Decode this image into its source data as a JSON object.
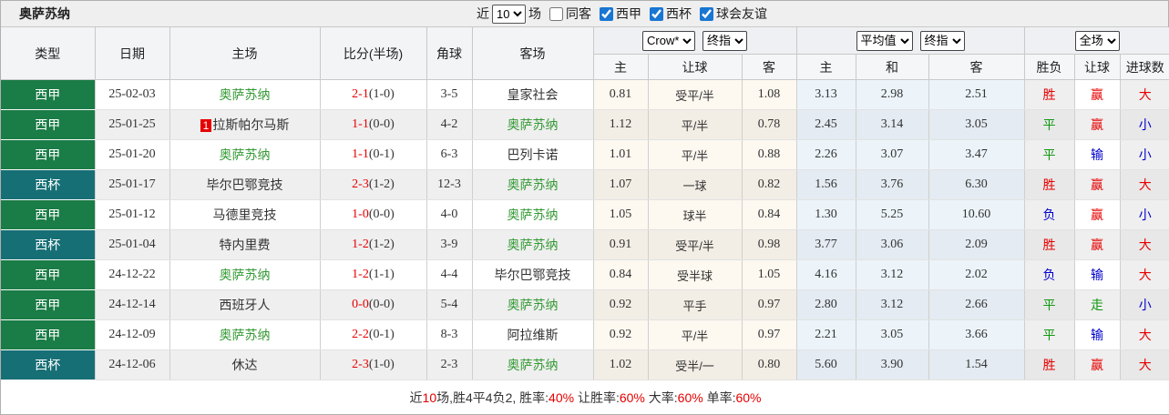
{
  "header": {
    "team": "奥萨苏纳",
    "recent_label": "近",
    "count": "10",
    "matches_label": "场",
    "filters": [
      {
        "label": "同客",
        "checked": false
      },
      {
        "label": "西甲",
        "checked": true
      },
      {
        "label": "西杯",
        "checked": true
      },
      {
        "label": "球会友谊",
        "checked": true
      }
    ]
  },
  "odds_selects": {
    "handicap_company": "Crow*",
    "handicap_stage": "终指",
    "euro_company": "平均值",
    "euro_stage": "终指",
    "scope": "全场"
  },
  "columns": {
    "type": "类型",
    "date": "日期",
    "home": "主场",
    "score": "比分(半场)",
    "corner": "角球",
    "away": "客场",
    "h_home": "主",
    "h_line": "让球",
    "h_away": "客",
    "e_home": "主",
    "e_draw": "和",
    "e_away": "客",
    "wdl": "胜负",
    "let": "让球",
    "goal": "进球数"
  },
  "colors": {
    "liga_green": "#1a7c46",
    "copa_teal": "#176f76",
    "self_team": "#339933",
    "win_red": "#e60000",
    "draw_green": "#119911",
    "lose_blue": "#0000cc"
  },
  "rows": [
    {
      "type": "西甲",
      "type_class": "liga",
      "date": "25-02-03",
      "home": "奥萨苏纳",
      "home_class": "self",
      "score": "2-1",
      "half": "(1-0)",
      "corners": "3-5",
      "away": "皇家社会",
      "h_home": "0.81",
      "h_line": "受平/半",
      "h_away": "1.08",
      "e_home": "3.13",
      "e_draw": "2.98",
      "e_away": "2.51",
      "res_wdl": "胜",
      "wdl_class": "c-red",
      "res_let": "赢",
      "let_class": "c-red",
      "res_goal": "大",
      "goal_class": "c-red"
    },
    {
      "type": "西甲",
      "type_class": "liga",
      "date": "25-01-25",
      "home_badge": "1",
      "home": "拉斯帕尔马斯",
      "score": "1-1",
      "half": "(0-0)",
      "corners": "4-2",
      "away": "奥萨苏纳",
      "away_class": "self",
      "h_home": "1.12",
      "h_line": "平/半",
      "h_away": "0.78",
      "e_home": "2.45",
      "e_draw": "3.14",
      "e_away": "3.05",
      "res_wdl": "平",
      "wdl_class": "c-green",
      "res_let": "赢",
      "let_class": "c-red",
      "res_goal": "小",
      "goal_class": "c-blue"
    },
    {
      "type": "西甲",
      "type_class": "liga",
      "date": "25-01-20",
      "home": "奥萨苏纳",
      "home_class": "self",
      "score": "1-1",
      "half": "(0-1)",
      "corners": "6-3",
      "away": "巴列卡诺",
      "h_home": "1.01",
      "h_line": "平/半",
      "h_away": "0.88",
      "e_home": "2.26",
      "e_draw": "3.07",
      "e_away": "3.47",
      "res_wdl": "平",
      "wdl_class": "c-green",
      "res_let": "输",
      "let_class": "c-blue",
      "res_goal": "小",
      "goal_class": "c-blue"
    },
    {
      "type": "西杯",
      "type_class": "copa",
      "date": "25-01-17",
      "home": "毕尔巴鄂竞技",
      "score": "2-3",
      "half": "(1-2)",
      "corners": "12-3",
      "away": "奥萨苏纳",
      "away_class": "self",
      "h_home": "1.07",
      "h_line": "一球",
      "h_away": "0.82",
      "e_home": "1.56",
      "e_draw": "3.76",
      "e_away": "6.30",
      "res_wdl": "胜",
      "wdl_class": "c-red",
      "res_let": "赢",
      "let_class": "c-red",
      "res_goal": "大",
      "goal_class": "c-red"
    },
    {
      "type": "西甲",
      "type_class": "liga",
      "date": "25-01-12",
      "home": "马德里竞技",
      "score": "1-0",
      "half": "(0-0)",
      "corners": "4-0",
      "away": "奥萨苏纳",
      "away_class": "self",
      "h_home": "1.05",
      "h_line": "球半",
      "h_away": "0.84",
      "e_home": "1.30",
      "e_draw": "5.25",
      "e_away": "10.60",
      "res_wdl": "负",
      "wdl_class": "c-blue",
      "res_let": "赢",
      "let_class": "c-red",
      "res_goal": "小",
      "goal_class": "c-blue"
    },
    {
      "type": "西杯",
      "type_class": "copa",
      "date": "25-01-04",
      "home": "特内里费",
      "score": "1-2",
      "half": "(1-2)",
      "corners": "3-9",
      "away": "奥萨苏纳",
      "away_class": "self",
      "h_home": "0.91",
      "h_line": "受平/半",
      "h_away": "0.98",
      "e_home": "3.77",
      "e_draw": "3.06",
      "e_away": "2.09",
      "res_wdl": "胜",
      "wdl_class": "c-red",
      "res_let": "赢",
      "let_class": "c-red",
      "res_goal": "大",
      "goal_class": "c-red"
    },
    {
      "type": "西甲",
      "type_class": "liga",
      "date": "24-12-22",
      "home": "奥萨苏纳",
      "home_class": "self",
      "score": "1-2",
      "half": "(1-1)",
      "corners": "4-4",
      "away": "毕尔巴鄂竞技",
      "h_home": "0.84",
      "h_line": "受半球",
      "h_away": "1.05",
      "e_home": "4.16",
      "e_draw": "3.12",
      "e_away": "2.02",
      "res_wdl": "负",
      "wdl_class": "c-blue",
      "res_let": "输",
      "let_class": "c-blue",
      "res_goal": "大",
      "goal_class": "c-red"
    },
    {
      "type": "西甲",
      "type_class": "liga",
      "date": "24-12-14",
      "home": "西班牙人",
      "score": "0-0",
      "half": "(0-0)",
      "corners": "5-4",
      "away": "奥萨苏纳",
      "away_class": "self",
      "h_home": "0.92",
      "h_line": "平手",
      "h_away": "0.97",
      "e_home": "2.80",
      "e_draw": "3.12",
      "e_away": "2.66",
      "res_wdl": "平",
      "wdl_class": "c-green",
      "res_let": "走",
      "let_class": "c-green",
      "res_goal": "小",
      "goal_class": "c-blue"
    },
    {
      "type": "西甲",
      "type_class": "liga",
      "date": "24-12-09",
      "home": "奥萨苏纳",
      "home_class": "self",
      "score": "2-2",
      "half": "(0-1)",
      "corners": "8-3",
      "away": "阿拉维斯",
      "h_home": "0.92",
      "h_line": "平/半",
      "h_away": "0.97",
      "e_home": "2.21",
      "e_draw": "3.05",
      "e_away": "3.66",
      "res_wdl": "平",
      "wdl_class": "c-green",
      "res_let": "输",
      "let_class": "c-blue",
      "res_goal": "大",
      "goal_class": "c-red"
    },
    {
      "type": "西杯",
      "type_class": "copa",
      "date": "24-12-06",
      "home": "休达",
      "score": "2-3",
      "half": "(1-0)",
      "corners": "2-3",
      "away": "奥萨苏纳",
      "away_class": "self",
      "h_home": "1.02",
      "h_line": "受半/一",
      "h_away": "0.80",
      "e_home": "5.60",
      "e_draw": "3.90",
      "e_away": "1.54",
      "res_wdl": "胜",
      "wdl_class": "c-red",
      "res_let": "赢",
      "let_class": "c-red",
      "res_goal": "大",
      "goal_class": "c-red"
    }
  ],
  "summary": {
    "p1": "近",
    "n1": "10",
    "p2": "场,胜4平4负2, 胜率:",
    "n2": "40%",
    "p3": " 让胜率:",
    "n3": "60%",
    "p4": " 大率:",
    "n4": "60%",
    "p5": " 单率:",
    "n5": "60%"
  }
}
